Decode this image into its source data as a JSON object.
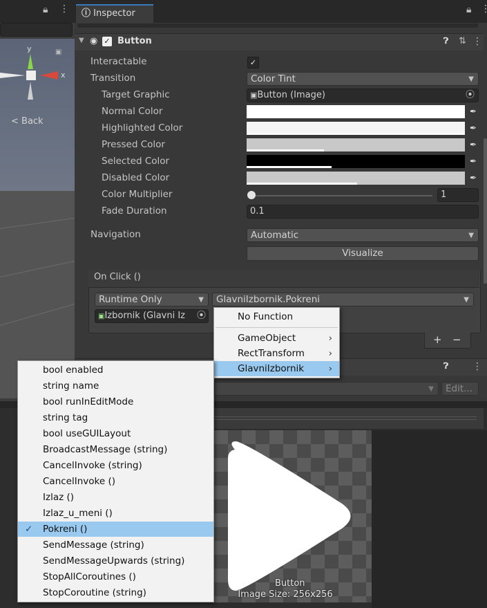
{
  "inspector": {
    "tab_label": "Inspector",
    "component_title": "Button"
  },
  "scene": {
    "back_label": "< Back",
    "axis_y": "y",
    "axis_x": "x"
  },
  "fields": {
    "interactable_label": "Interactable",
    "transition_label": "Transition",
    "transition_value": "Color Tint",
    "target_graphic_label": "Target Graphic",
    "target_graphic_value": "Button (Image)",
    "normal_color_label": "Normal Color",
    "highlighted_color_label": "Highlighted Color",
    "pressed_color_label": "Pressed Color",
    "selected_color_label": "Selected Color",
    "disabled_color_label": "Disabled Color",
    "color_multiplier_label": "Color Multiplier",
    "color_multiplier_value": "1",
    "fade_duration_label": "Fade Duration",
    "fade_duration_value": "0.1",
    "navigation_label": "Navigation",
    "navigation_value": "Automatic",
    "visualize_label": "Visualize"
  },
  "colors": {
    "normal": "#FFFFFF",
    "highlighted": "#F5F5F5",
    "pressed": "#C8C8C8",
    "selected": "#000000",
    "disabled": "#C8C8C8"
  },
  "onclick": {
    "header": "On Click ()",
    "runtime_value": "Runtime Only",
    "function_value": "GlavniIzbornik.Pokreni",
    "object_value": "Izbornik (Glavni Iz",
    "plus": "+",
    "minus": "−"
  },
  "component2": {
    "edit_label": "Edit..."
  },
  "preview": {
    "name": "Button",
    "size": "Image Size: 256x256"
  },
  "function_menu": {
    "items": [
      "No Function",
      "GameObject",
      "RectTransform",
      "GlavniIzbornik"
    ]
  },
  "method_menu": {
    "items": [
      "bool enabled",
      "string name",
      "bool runInEditMode",
      "string tag",
      "bool useGUILayout",
      "BroadcastMessage (string)",
      "CancelInvoke (string)",
      "CancelInvoke ()",
      "Izlaz ()",
      "Izlaz_u_meni ()",
      "Pokreni ()",
      "SendMessage (string)",
      "SendMessageUpwards (string)",
      "StopAllCoroutines ()",
      "StopCoroutine (string)"
    ],
    "checked_item": "Pokreni ()"
  }
}
